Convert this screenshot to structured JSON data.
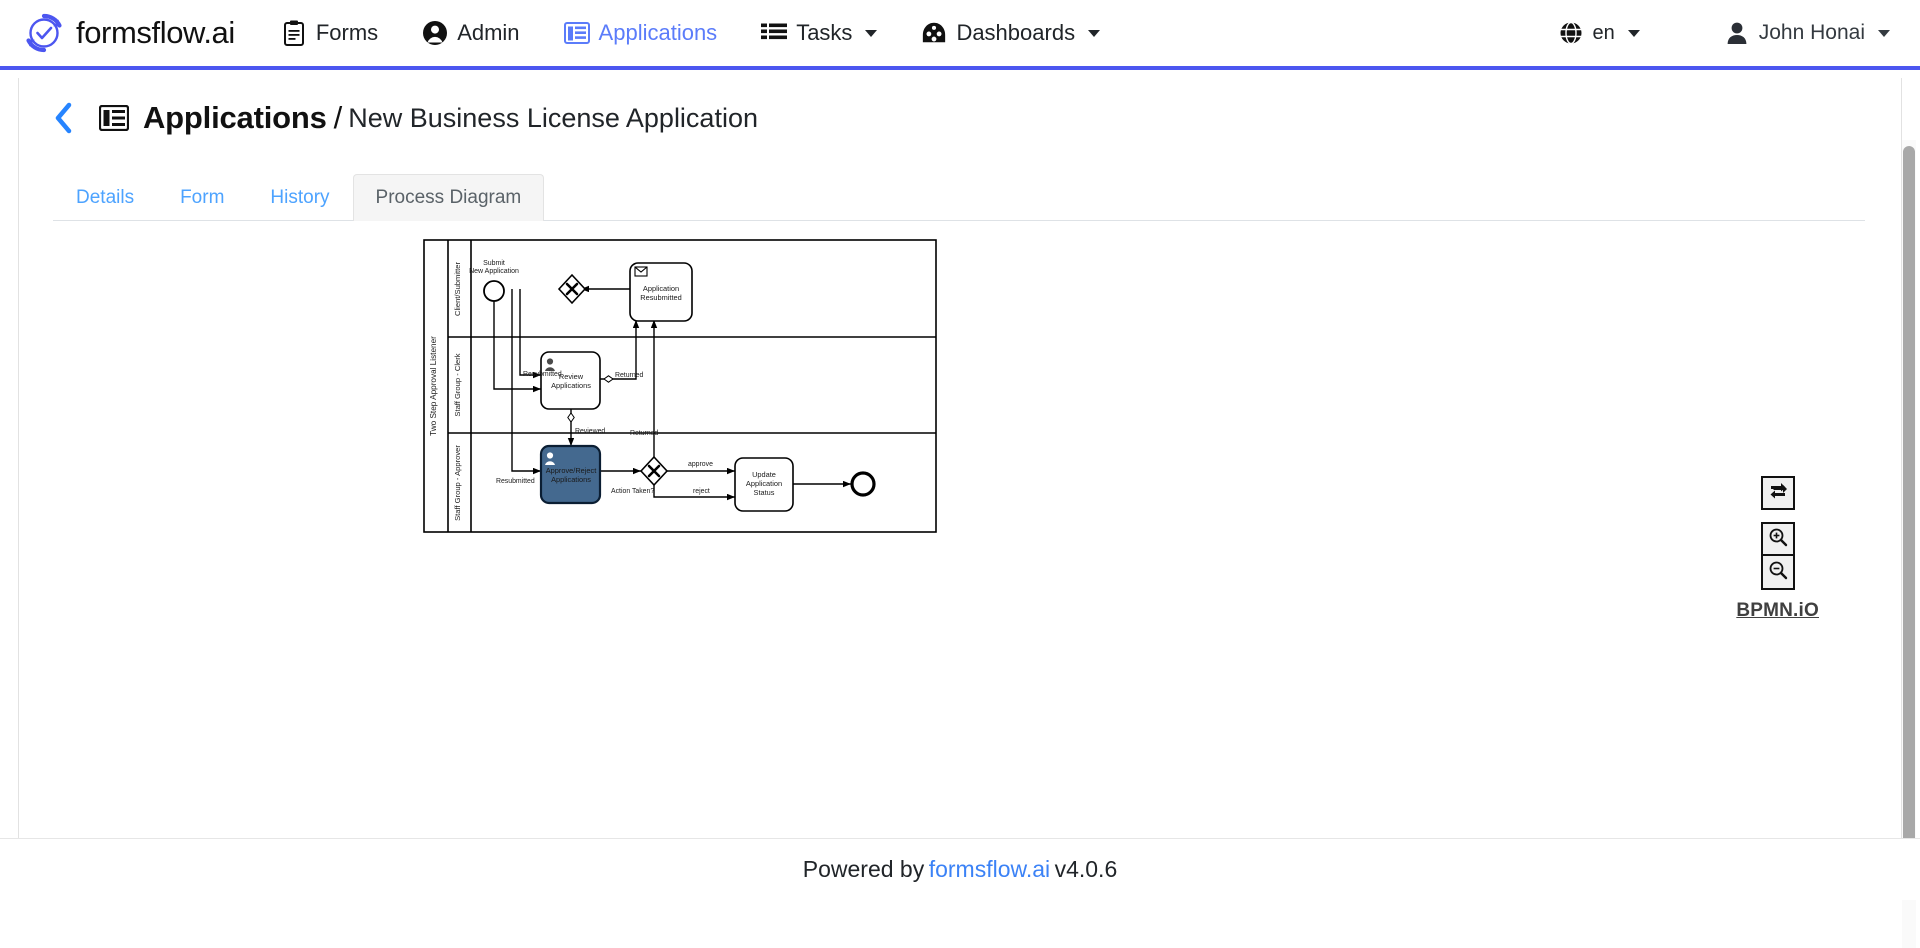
{
  "navbar": {
    "brand": "formsflow.ai",
    "brand_icon": "refresh-check-logo-icon",
    "items": [
      {
        "label": "Forms",
        "icon": "form-list-icon",
        "active": false,
        "caret": false
      },
      {
        "label": "Admin",
        "icon": "user-circle-icon",
        "active": false,
        "caret": false
      },
      {
        "label": "Applications",
        "icon": "applications-list-icon",
        "active": true,
        "caret": false
      },
      {
        "label": "Tasks",
        "icon": "tasks-list-icon",
        "active": false,
        "caret": true
      },
      {
        "label": "Dashboards",
        "icon": "dashboard-gauge-icon",
        "active": false,
        "caret": true
      }
    ],
    "language": {
      "label": "en",
      "icon": "globe-icon"
    },
    "user": {
      "label": "John Honai",
      "icon": "user-icon"
    }
  },
  "page": {
    "back_icon": "chevron-left-icon",
    "title_icon": "applications-list-icon",
    "title": "Applications",
    "separator": "/",
    "subtitle": "New Business License Application"
  },
  "tabs": [
    {
      "label": "Details",
      "active": false
    },
    {
      "label": "Form",
      "active": false
    },
    {
      "label": "History",
      "active": false
    },
    {
      "label": "Process Diagram",
      "active": true
    }
  ],
  "bpmn": {
    "pool_label": "Two Step Approval Listener",
    "lanes": [
      {
        "label": "Client/Submitter"
      },
      {
        "label": "Staff Group -  Clerk"
      },
      {
        "label": "Staff Group - Approver"
      }
    ],
    "nodes": {
      "start_event_label_line1": "Submit",
      "start_event_label_line2": "New Application",
      "gateway_top": "X",
      "message_task_line1": "Application",
      "message_task_line2": "Resubmitted",
      "review_task_line1": "Review",
      "review_task_line2": "Applications",
      "approve_task_line1": "Approve/Reject",
      "approve_task_line2": "Applications",
      "gateway_bottom": "X",
      "update_task_line1": "Update",
      "update_task_line2": "Application",
      "update_task_line3": "Status"
    },
    "flow_labels": {
      "resubmitted_clerk": "Resubmitted",
      "returned_clerk": "Returned",
      "reviewed": "Reviewed",
      "returned_approver": "Returned",
      "resubmitted_approver": "Resubmitted",
      "action_taken": "Action Taken?",
      "approve": "approve",
      "reject": "reject"
    },
    "highlight_color": "#44698f",
    "highlight_stroke": "#0b1e33",
    "controls": [
      {
        "name": "reset-zoom-button",
        "icon": "reset-arrows-icon"
      },
      {
        "name": "zoom-in-button",
        "icon": "zoom-in-icon"
      },
      {
        "name": "zoom-out-button",
        "icon": "zoom-out-icon"
      }
    ],
    "logo_text": "BPMN.iO"
  },
  "footer": {
    "powered_by": "Powered by",
    "link": "formsflow.ai",
    "version": "v4.0.6"
  },
  "colors": {
    "accent_blue": "#4c56f0",
    "link_blue": "#3b82f6",
    "nav_active": "#5b7cfa",
    "tab_link": "#4da3ff"
  }
}
